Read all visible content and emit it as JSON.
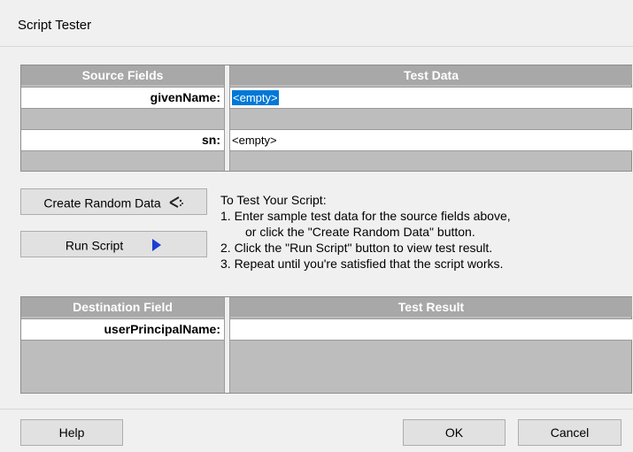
{
  "window": {
    "title": "Script Tester"
  },
  "source_panel": {
    "col_field": "Source Fields",
    "col_value": "Test Data",
    "rows": [
      {
        "label": "givenName:",
        "value": "<empty>"
      },
      {
        "label": "sn:",
        "value": "<empty>"
      }
    ]
  },
  "buttons": {
    "random": "Create Random Data",
    "run": "Run Script",
    "help": "Help",
    "ok": "OK",
    "cancel": "Cancel"
  },
  "instructions": {
    "heading": "To Test Your Script:",
    "line1": "1. Enter sample test data for the source fields above,",
    "line1b": "or click the \"Create Random Data\" button.",
    "line2": "2. Click the \"Run Script\" button to view test result.",
    "line3": "3. Repeat until you're satisfied that the script works."
  },
  "result_panel": {
    "col_field": "Destination Field",
    "col_value": "Test Result",
    "rows": [
      {
        "label": "userPrincipalName:",
        "value": ""
      }
    ]
  },
  "icons": {
    "random": "magic-wand-icon",
    "run": "play-triangle-icon"
  },
  "colors": {
    "selection": "#0078d7",
    "run_arrow": "#1a3fd6",
    "header_bg": "#a8a8a8"
  }
}
